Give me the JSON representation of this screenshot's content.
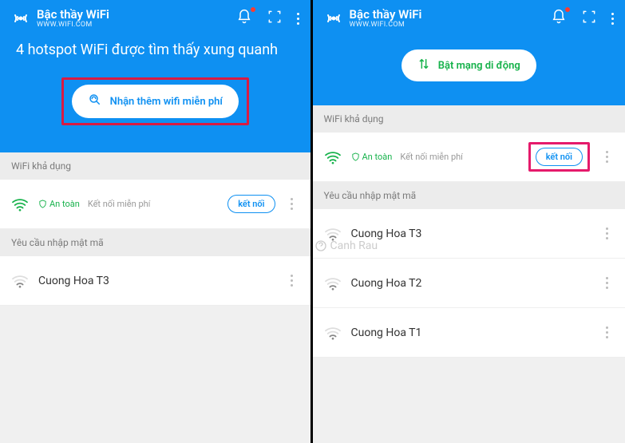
{
  "app": {
    "title": "Bậc thầy WiFi",
    "subtitle": "WWW.WIFI.COM"
  },
  "left": {
    "hero": "4 hotspot WiFi được tìm thấy xung quanh",
    "cta": "Nhận thêm wifi miễn phí",
    "sections": {
      "available": "WiFi khả dụng",
      "password": "Yêu cầu nhập mật mã"
    },
    "available_row": {
      "safe": "An toàn",
      "free": "Kết nối miễn phí",
      "connect": "kết nối"
    },
    "locked": [
      {
        "name": "Cuong Hoa T3"
      }
    ]
  },
  "right": {
    "cta": "Bật mạng di động",
    "sections": {
      "available": "WiFi khả dụng",
      "password": "Yêu cầu nhập mật mã"
    },
    "available_row": {
      "safe": "An toàn",
      "free": "Kết nối miễn phí",
      "connect": "kết nối"
    },
    "locked": [
      {
        "name": "Cuong Hoa T3"
      },
      {
        "name": "Cuong Hoa T2"
      },
      {
        "name": "Cuong Hoa T1"
      }
    ],
    "watermark": "Canh Rau"
  }
}
